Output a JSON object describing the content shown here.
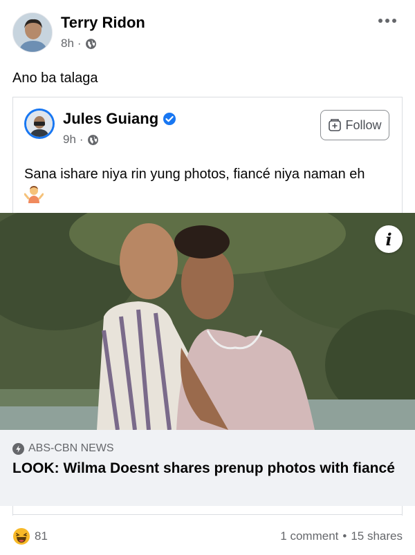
{
  "post": {
    "author": "Terry Ridon",
    "time": "8h",
    "separator": "·",
    "text": "Ano ba talaga"
  },
  "shared": {
    "author": "Jules Guiang",
    "time": "9h",
    "separator": "·",
    "follow_label": "Follow",
    "text": "Sana ishare niya rin yung photos, fiancé niya naman eh"
  },
  "link": {
    "source": "ABS-CBN NEWS",
    "title": "LOOK: Wilma Doesnt shares prenup photos with fiancé",
    "info_label": "i"
  },
  "footer": {
    "reaction_count": "81",
    "comments": "1 comment",
    "dot": "•",
    "shares": "15 shares"
  },
  "colors": {
    "brand": "#1877f2",
    "secondary_text": "#65676b",
    "link_bg": "#f0f2f5"
  },
  "icons": {
    "more": "more-horizontal-icon",
    "privacy": "globe-icon",
    "verified": "verified-badge-icon",
    "follow": "follow-plus-icon",
    "emoji": "shrug-emoji-icon",
    "info": "info-icon",
    "source": "abs-cbn-source-icon",
    "reaction": "haha-reaction-icon"
  }
}
